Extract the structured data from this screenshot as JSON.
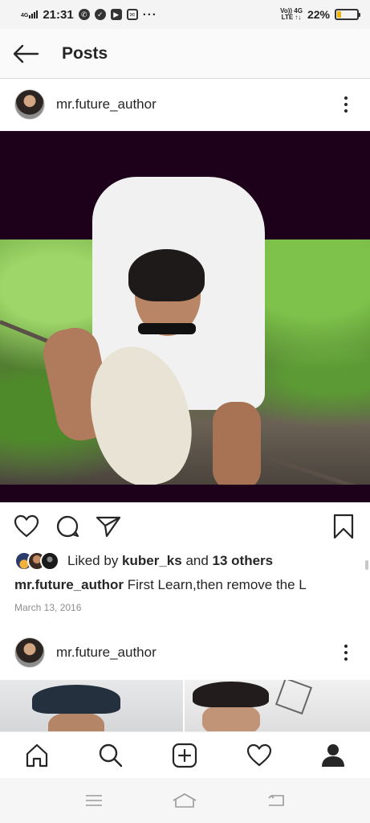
{
  "status_bar": {
    "network": "4G",
    "time": "21:31",
    "volte_top": "Vo)) 4G",
    "volte_bottom": "LTE ↑↓",
    "battery_percent": "22%",
    "battery_level": 0.22,
    "dots": "···",
    "icons": [
      "whatsapp-icon",
      "check-circle-icon",
      "youtube-icon",
      "gmail-icon"
    ]
  },
  "header": {
    "title": "Posts",
    "back_icon": "arrow-left-icon"
  },
  "post1": {
    "username": "mr.future_author",
    "liked_by_prefix": "Liked by ",
    "liked_by_user": "kuber_ks",
    "liked_by_mid": " and ",
    "liked_by_count": "13 others",
    "caption_user": "mr.future_author",
    "caption_text": " First Learn,then remove the L",
    "date": "March 13, 2016"
  },
  "post2": {
    "username": "mr.future_author"
  },
  "bottom_nav": [
    "home-icon",
    "search-icon",
    "add-post-icon",
    "activity-heart-icon",
    "profile-icon"
  ],
  "system_nav": [
    "menu-icon",
    "home-icon",
    "back-icon"
  ],
  "colors": {
    "battery": "#f2b200",
    "photo_frame": "#1d0019",
    "text": "#262626",
    "muted": "#8e8e8e"
  }
}
